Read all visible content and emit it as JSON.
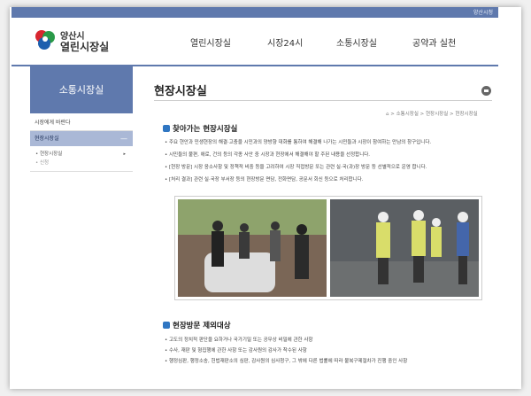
{
  "topbar": {
    "link": "양산시청"
  },
  "logo": {
    "city": "양산시",
    "name": "열린시장실"
  },
  "gnb": [
    "열린시장실",
    "시장24시",
    "소통시장실",
    "공약과 실천"
  ],
  "sidebar": {
    "title": "소통시장실",
    "items": [
      {
        "label": "시장에게 바란다"
      },
      {
        "label": "현장시장실"
      }
    ],
    "subitems": [
      {
        "label": "• 현장시장실",
        "arrow": "▸"
      },
      {
        "label": "• 신청"
      }
    ]
  },
  "page": {
    "title": "현장시장실",
    "breadcrumb": "⌂ > 소통시장실 > 현장시장실 > 현장시장실"
  },
  "section1": {
    "heading": "찾아가는 현장시장실",
    "bullets": [
      "• 주요 현안과 민생현장의 해결·고충을 시민과의 양방향 대화를 통하여 해결해 나가는 시민들과 시장이 참여하는 만남의 창구입니다.",
      "• 시민들의 불편, 애로, 건의 등의 각종 사안 중 시장과 현장에서 해결해야 할 주된 내용을 선정합니다.",
      "• [현장 방문] 시장 응소사항 및 정책적 비중 등을 고려하여 시장 직접방문 또는 관련 실·국(과)장 방문 등 선별적으로 운영 합니다.",
      "• [처리 결과] 관련 실·국장 부서장 등의 현장방문 면담, 전화면담, 공문서 회신 등으로 처리합니다."
    ]
  },
  "photos": [
    {
      "alt": "현장 방문 사진 1"
    },
    {
      "alt": "현장 방문 사진 2"
    }
  ],
  "section2": {
    "heading": "현장방문 제외대상",
    "bullets": [
      "• 고도의 정치적 판단을 요하거나 국가기밀 또는 공무상 비밀에 관한 사항",
      "• 수사, 재판 및 형집행에 관한 사항 또는 감사원의 감사가 착수된 사항",
      "• 행정심판, 행정소송, 헌법재판소의 심판, 감사원의 심사청구, 그 밖에 다른 법률에 따라 불복구제절차가 진행 중인 사항"
    ]
  },
  "colors": {
    "accent": "#5f79ad",
    "icon": "#2f76c2"
  }
}
